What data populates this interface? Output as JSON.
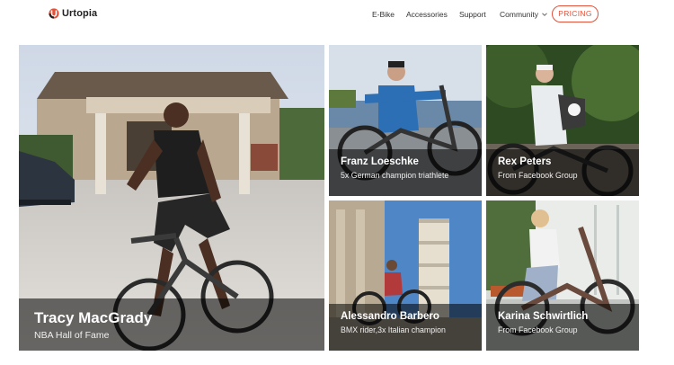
{
  "header": {
    "brand": "Urtopia",
    "nav": {
      "ebike": "E-Bike",
      "accessories": "Accessories",
      "support": "Support",
      "community": "Community"
    },
    "pricing": "PRICING",
    "accent_color": "#e2513a"
  },
  "riders": {
    "tracy": {
      "name": "Tracy MacGrady",
      "subtitle": "NBA Hall of Fame"
    },
    "franz": {
      "name": "Franz Loeschke",
      "subtitle": "5x German champion triathlete"
    },
    "rex": {
      "name": "Rex Peters",
      "subtitle": "From Facebook Group"
    },
    "alessandro": {
      "name": "Alessandro Barbero",
      "subtitle": "BMX rider,3x Italian champion"
    },
    "karina": {
      "name": "Karina Schwirtlich",
      "subtitle": "From Facebook Group"
    }
  }
}
